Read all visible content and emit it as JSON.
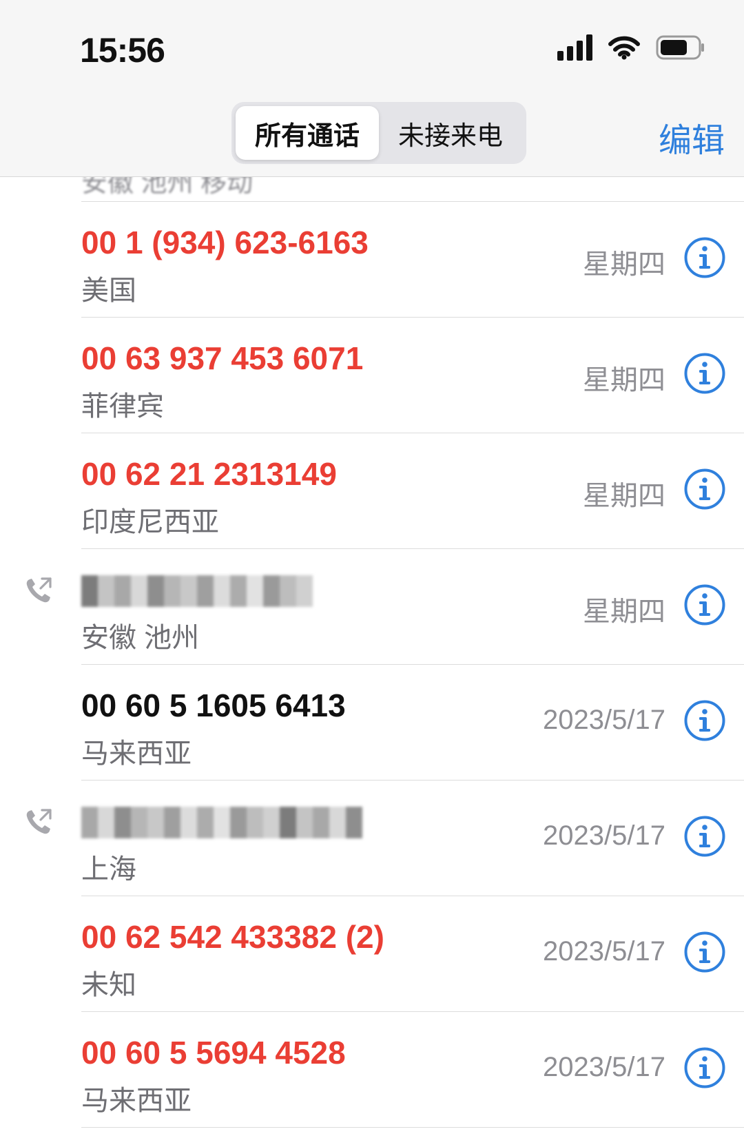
{
  "status_bar": {
    "time": "15:56",
    "icons": [
      "cellular-signal-icon",
      "wifi-icon",
      "battery-icon"
    ]
  },
  "segmented_control": {
    "items": [
      {
        "label": "所有通话",
        "selected": true
      },
      {
        "label": "未接来电",
        "selected": false
      }
    ]
  },
  "edit_button": {
    "label": "编辑"
  },
  "calls": [
    {
      "number": "00 1 (934) 623-6163",
      "location": "美国",
      "date": "星期四",
      "missed": true,
      "outgoing": false
    },
    {
      "number": "00 63 937 453 6071",
      "location": "菲律宾",
      "date": "星期四",
      "missed": true,
      "outgoing": false
    },
    {
      "number": "00 62 21 2313149",
      "location": "印度尼西亚",
      "date": "星期四",
      "missed": true,
      "outgoing": false
    },
    {
      "number": "",
      "location": "安徽 池州",
      "date": "星期四",
      "missed": false,
      "outgoing": true,
      "redacted": true
    },
    {
      "number": "00 60 5 1605 6413",
      "location": "马来西亚",
      "date": "2023/5/17",
      "missed": false,
      "outgoing": false
    },
    {
      "number": "",
      "location": "上海",
      "date": "2023/5/17",
      "missed": false,
      "outgoing": true,
      "redacted": true
    },
    {
      "number": "00 62 542 433382 (2)",
      "location": "未知",
      "date": "2023/5/17",
      "missed": true,
      "outgoing": false
    },
    {
      "number": "00 60 5 5694 4528",
      "location": "马来西亚",
      "date": "2023/5/17",
      "missed": true,
      "outgoing": false
    }
  ],
  "colors": {
    "missed": "#ea3e34",
    "accent": "#2f80dd",
    "secondary_text": "#8e8e93"
  }
}
